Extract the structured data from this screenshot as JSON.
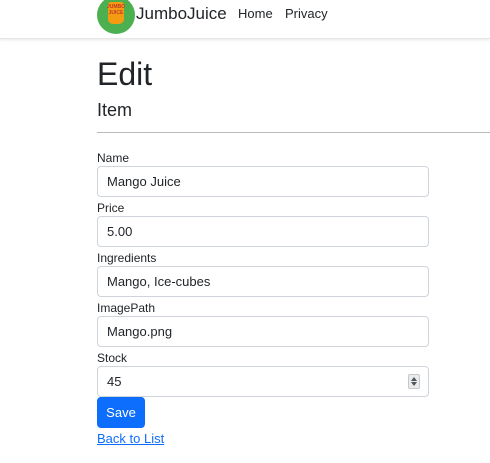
{
  "navbar": {
    "logo_text": "JUMBO JUICE",
    "brand": "JumboJuice",
    "links": [
      "Home",
      "Privacy"
    ]
  },
  "page": {
    "title": "Edit",
    "subtitle": "Item"
  },
  "form": {
    "fields": [
      {
        "label": "Name",
        "value": "Mango Juice"
      },
      {
        "label": "Price",
        "value": "5.00"
      },
      {
        "label": "Ingredients",
        "value": "Mango, Ice-cubes"
      },
      {
        "label": "ImagePath",
        "value": "Mango.png"
      },
      {
        "label": "Stock",
        "value": "45"
      }
    ],
    "save_label": "Save"
  },
  "back_link": "Back to List",
  "colors": {
    "primary": "#0d6efd",
    "logo_green": "#4caf50",
    "logo_orange": "#f39c12"
  }
}
